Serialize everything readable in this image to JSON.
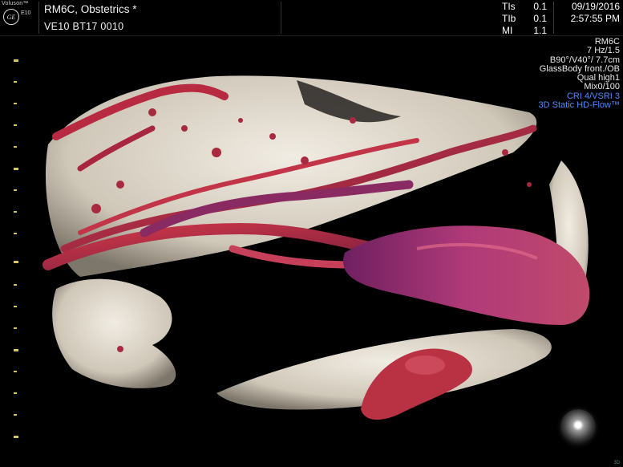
{
  "header": {
    "logo_brand": "Voluson™",
    "logo_mark": "GE",
    "logo_model": "E10",
    "probe_exam": "RM6C, Obstetrics  *",
    "session_id": "VE10 BT17  0010",
    "thermal_indices": [
      {
        "label": "TIs",
        "value": "0.1"
      },
      {
        "label": "TIb",
        "value": "0.1"
      },
      {
        "label": "MI",
        "value": "1.1"
      }
    ],
    "date": "09/19/2016",
    "time": "2:57:55 PM"
  },
  "settings": {
    "probe": "RM6C",
    "frequency": "7 Hz/1.5",
    "volume_angles": "B90°/V40°/ 7.7cm",
    "render_mode": "GlassBody front./OB",
    "quality": "Qual high1",
    "mix": "Mix0/100",
    "cri": "CRI 4/VSRI 3",
    "mode": "3D Static HD-Flow™"
  },
  "corner_tag": "3D",
  "colors": {
    "background": "#000000",
    "overlay_text": "#f2f2f2",
    "highlight_blue": "#4f8bff",
    "scale_tick": "#d8c85a",
    "tissue": "#e6e0d6",
    "vessel_red": "#b8283c",
    "vessel_purple": "#8c2a6a"
  },
  "icons": {
    "logo": "ge-logo-icon",
    "orientation": "orientation-sphere-icon"
  }
}
